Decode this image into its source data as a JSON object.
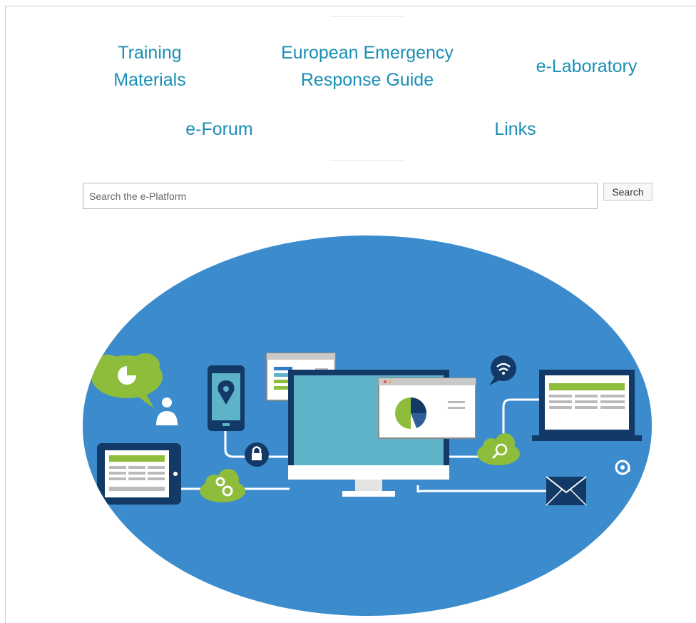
{
  "nav": {
    "training_materials": [
      "Training",
      "Materials"
    ],
    "eerg": [
      "European Emergency",
      "Response Guide"
    ],
    "e_laboratory": "e-Laboratory",
    "e_forum": "e-Forum",
    "links": "Links"
  },
  "search": {
    "placeholder": "Search the e-Platform",
    "value": "",
    "button_label": "Search"
  },
  "hero": {
    "icons": [
      "speech-bubble-chart-icon",
      "user-icon",
      "phone-location-icon",
      "bar-chart-window-icon",
      "desktop-monitor-icon",
      "pie-chart-window-icon",
      "wifi-bubble-icon",
      "laptop-icon",
      "tablet-icon",
      "lock-icon",
      "cloud-settings-icon",
      "cloud-search-icon",
      "envelope-icon",
      "at-sign-icon"
    ]
  },
  "colors": {
    "link": "#1a8fb5",
    "hero_blue": "#3c8ccd",
    "dark_navy": "#133a66",
    "screen_teal": "#5eb3c9",
    "accent_green": "#8dbd3a"
  }
}
